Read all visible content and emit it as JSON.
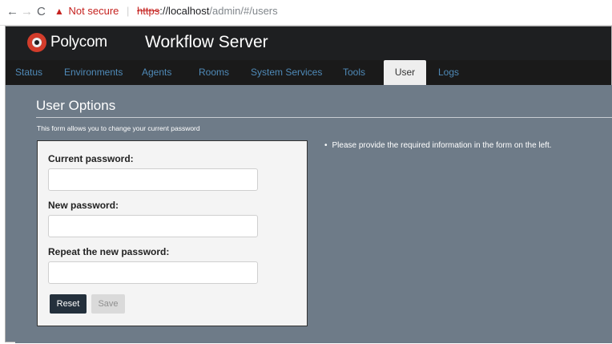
{
  "browser": {
    "back_icon": "←",
    "forward_icon": "→",
    "reload_icon": "C",
    "warning_icon": "▲",
    "not_secure": "Not secure",
    "scheme": "https",
    "host": "://localhost",
    "path": "/admin/#/users"
  },
  "header": {
    "brand": "Polycom",
    "product": "Workflow Server",
    "logo_color": "#d23c2b"
  },
  "tabs": [
    {
      "label": "Status"
    },
    {
      "label": "Environments"
    },
    {
      "label": "Agents"
    },
    {
      "label": "Rooms"
    },
    {
      "label": "System Services"
    },
    {
      "label": "Tools"
    },
    {
      "label": "User",
      "active": true
    },
    {
      "label": "Logs"
    }
  ],
  "section": {
    "title": "User Options",
    "description": "This form allows you to change your current password"
  },
  "form": {
    "current_label": "Current password:",
    "new_label": "New password:",
    "repeat_label": "Repeat the new password:",
    "current_value": "",
    "new_value": "",
    "repeat_value": "",
    "reset_label": "Reset",
    "save_label": "Save"
  },
  "info": {
    "message": "Please provide the required information in the form on the left."
  }
}
